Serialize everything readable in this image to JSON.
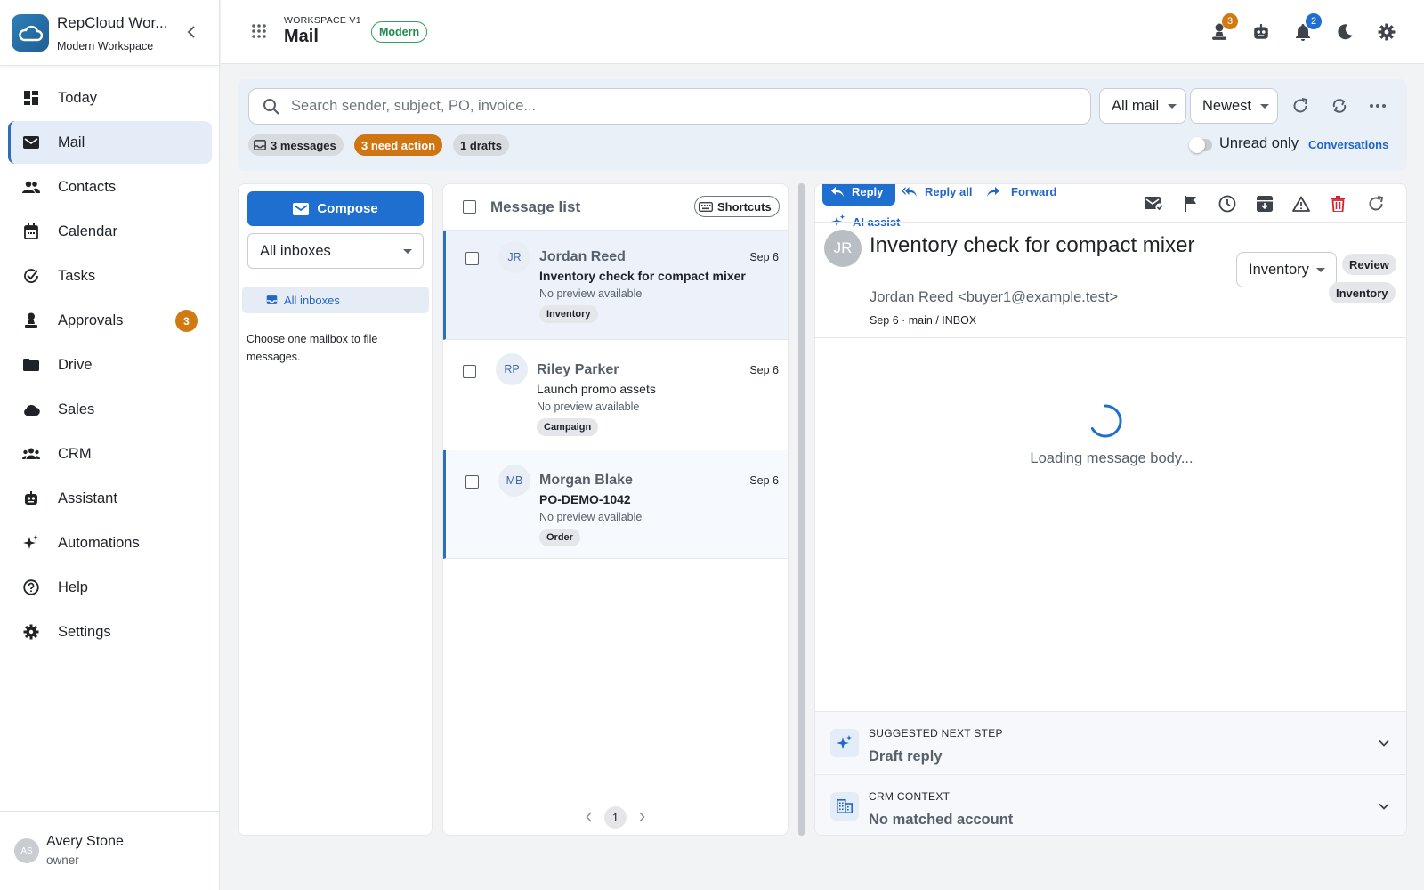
{
  "brand": {
    "title": "RepCloud Wor...",
    "subtitle": "Modern Workspace"
  },
  "nav": [
    {
      "label": "Today",
      "icon": "dashboard-icon"
    },
    {
      "label": "Mail",
      "icon": "mail-icon",
      "active": true
    },
    {
      "label": "Contacts",
      "icon": "people-icon"
    },
    {
      "label": "Calendar",
      "icon": "calendar-icon"
    },
    {
      "label": "Tasks",
      "icon": "task-check-icon"
    },
    {
      "label": "Approvals",
      "icon": "approval-icon",
      "badge": "3"
    },
    {
      "label": "Drive",
      "icon": "folder-icon"
    },
    {
      "label": "Sales",
      "icon": "cloud-icon"
    },
    {
      "label": "CRM",
      "icon": "groups-icon"
    },
    {
      "label": "Assistant",
      "icon": "robot-icon"
    },
    {
      "label": "Automations",
      "icon": "sparkle-icon"
    },
    {
      "label": "Help",
      "icon": "help-icon"
    },
    {
      "label": "Settings",
      "icon": "gear-icon"
    }
  ],
  "user": {
    "initials": "AS",
    "name": "Avery Stone",
    "role": "owner"
  },
  "header": {
    "workspace_label": "WORKSPACE V1",
    "title": "Mail",
    "mode_badge": "Modern",
    "approvals_badge": "3",
    "notifications_badge": "2",
    "badge_colors": {
      "approvals": "#d17a12",
      "notifications": "#1f6fd1"
    }
  },
  "toolbar": {
    "search_placeholder": "Search sender, subject, PO, invoice...",
    "filter_value": "All mail",
    "sort_value": "Newest",
    "chips": {
      "messages": "3 messages",
      "need_action": "3 need action",
      "drafts": "1 drafts"
    },
    "unread_only_label": "Unread only",
    "conversations_label": "Conversations"
  },
  "folders": {
    "compose_label": "Compose",
    "inbox_select": "All inboxes",
    "active_folder": "All inboxes",
    "hint": "Choose one mailbox to file messages."
  },
  "message_list": {
    "title": "Message list",
    "shortcuts_label": "Shortcuts",
    "messages": [
      {
        "initials": "JR",
        "sender": "Jordan Reed",
        "subject": "Inventory check for compact mixer",
        "preview": "No preview available",
        "date": "Sep 6",
        "tag": "Inventory"
      },
      {
        "initials": "RP",
        "sender": "Riley Parker",
        "subject": "Launch promo assets",
        "preview": "No preview available",
        "date": "Sep 6",
        "tag": "Campaign"
      },
      {
        "initials": "MB",
        "sender": "Morgan Blake",
        "subject": "PO-DEMO-1042",
        "preview": "No preview available",
        "date": "Sep 6",
        "tag": "Order"
      }
    ],
    "page": "1"
  },
  "reader": {
    "reply_label": "Reply",
    "reply_all_label": "Reply all",
    "forward_label": "Forward",
    "ai_assist_label": "AI assist",
    "avatar_initials": "JR",
    "subject": "Inventory check for compact mixer",
    "from": "Jordan Reed <buyer1@example.test>",
    "meta": "Sep 6 · main / INBOX",
    "category": "Inventory",
    "tags": {
      "review": "Review",
      "inventory": "Inventory"
    },
    "loading_text": "Loading message body...",
    "next_step": {
      "kicker": "SUGGESTED NEXT STEP",
      "title": "Draft reply"
    },
    "crm": {
      "kicker": "CRM CONTEXT",
      "title": "No matched account"
    }
  }
}
